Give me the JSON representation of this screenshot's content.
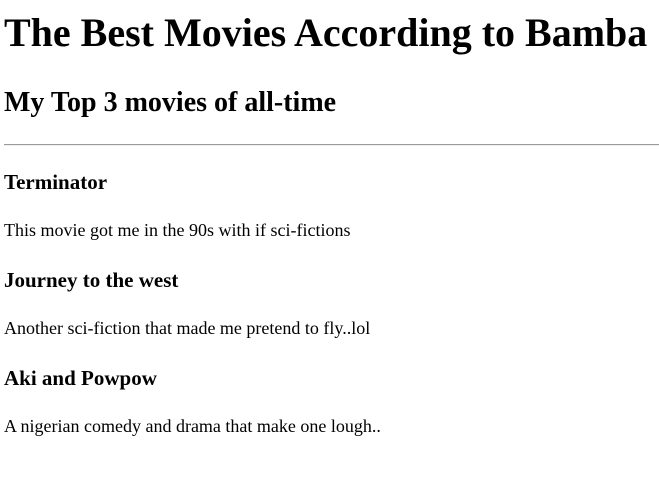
{
  "page": {
    "title": "The Best Movies According to Bamba",
    "subtitle": "My Top 3 movies of all-time"
  },
  "movies": [
    {
      "title": "Terminator",
      "description": "This movie got me in the 90s with if sci-fictions"
    },
    {
      "title": "Journey to the west",
      "description": "Another sci-fiction that made me pretend to fly..lol"
    },
    {
      "title": "Aki and Powpow",
      "description": "A nigerian comedy and drama that make one lough.."
    }
  ]
}
